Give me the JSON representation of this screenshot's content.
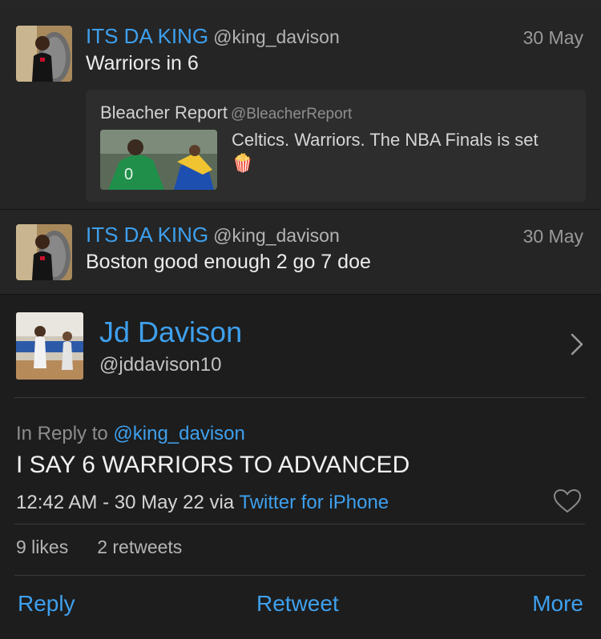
{
  "tweets": [
    {
      "name": "ITS DA KING",
      "handle": "@king_davison",
      "date": "30 May",
      "text": "Warriors in 6",
      "quote": {
        "name": "Bleacher Report",
        "handle": "@BleacherReport",
        "text": "Celtics. Warriors. The NBA Finals is set",
        "emoji": "🍿"
      }
    },
    {
      "name": "ITS DA KING",
      "handle": "@king_davison",
      "date": "30 May",
      "text": "Boston good enough 2 go 7 doe"
    }
  ],
  "detail": {
    "name": "Jd Davison",
    "handle": "@jddavison10",
    "reply_prefix": "In Reply to",
    "reply_handle": "@king_davison",
    "text": "I SAY 6 WARRIORS TO ADVANCED",
    "timestamp": "12:42 AM - 30 May 22",
    "via_prefix": "via",
    "source": "Twitter for iPhone",
    "likes": "9 likes",
    "retweets": "2 retweets"
  },
  "actions": {
    "reply": "Reply",
    "retweet": "Retweet",
    "more": "More"
  },
  "icons": {
    "chevron": "chevron-right-icon",
    "heart": "heart-outline-icon"
  },
  "colors": {
    "accent": "#3ea0ee",
    "background": "#1f1f1f"
  }
}
